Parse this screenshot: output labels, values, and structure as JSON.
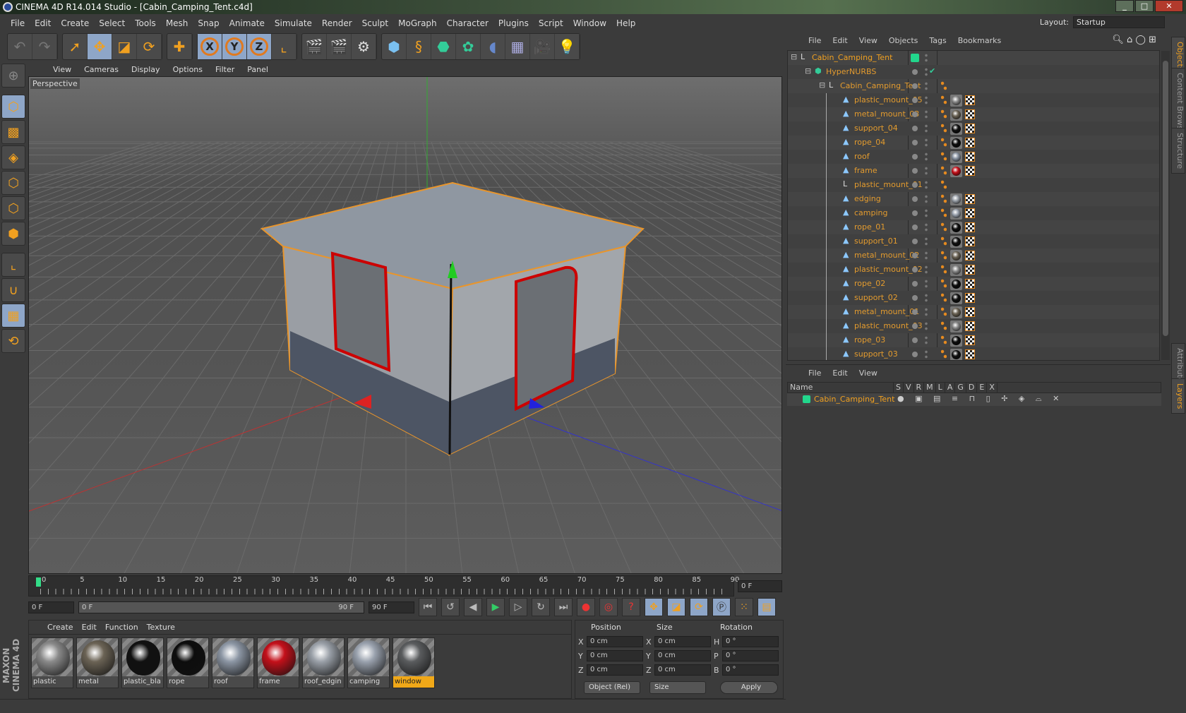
{
  "window": {
    "title": "CINEMA 4D R14.014 Studio - [Cabin_Camping_Tent.c4d]",
    "controls": [
      "_",
      "□",
      "✕"
    ]
  },
  "menu": [
    "File",
    "Edit",
    "Create",
    "Select",
    "Tools",
    "Mesh",
    "Snap",
    "Animate",
    "Simulate",
    "Render",
    "Sculpt",
    "MoGraph",
    "Character",
    "Plugins",
    "Script",
    "Window",
    "Help"
  ],
  "layout": {
    "label": "Layout:",
    "value": "Startup"
  },
  "toolbar": {
    "axes": [
      "X",
      "Y",
      "Z"
    ]
  },
  "viewport": {
    "menu": [
      "View",
      "Cameras",
      "Display",
      "Options",
      "Filter",
      "Panel"
    ],
    "label": "Perspective"
  },
  "timeline": {
    "ticks": [
      "0",
      "5",
      "10",
      "15",
      "20",
      "25",
      "30",
      "35",
      "40",
      "45",
      "50",
      "55",
      "60",
      "65",
      "70",
      "75",
      "80",
      "85",
      "90"
    ],
    "current": "0 F",
    "start": "0 F",
    "range_start": "0 F",
    "range_end": "90 F",
    "end": "90 F"
  },
  "materials": {
    "menu": [
      "Create",
      "Edit",
      "Function",
      "Texture"
    ],
    "items": [
      {
        "name": "plastic",
        "color": "#8a8a8a"
      },
      {
        "name": "metal",
        "color": "#6b6355"
      },
      {
        "name": "plastic_bla",
        "color": "#111111"
      },
      {
        "name": "rope",
        "color": "#0d0d0d"
      },
      {
        "name": "roof",
        "color": "#8c96a4"
      },
      {
        "name": "frame",
        "color": "#c4101a"
      },
      {
        "name": "roof_edgin",
        "color": "#9aa0a8"
      },
      {
        "name": "camping",
        "color": "#9aa2ae"
      },
      {
        "name": "window",
        "color": "#5a5c5e",
        "selected": true
      }
    ]
  },
  "coords": {
    "headers": [
      "Position",
      "Size",
      "Rotation"
    ],
    "rows": [
      {
        "a": "X",
        "p": "0 cm",
        "s": "X",
        "sv": "0 cm",
        "r": "H",
        "rv": "0 °"
      },
      {
        "a": "Y",
        "p": "0 cm",
        "s": "Y",
        "sv": "0 cm",
        "r": "P",
        "rv": "0 °"
      },
      {
        "a": "Z",
        "p": "0 cm",
        "s": "Z",
        "sv": "0 cm",
        "r": "B",
        "rv": "0 °"
      }
    ],
    "mode": "Object (Rel)",
    "size_mode": "Size",
    "apply": "Apply"
  },
  "logo": "MAXON CINEMA 4D",
  "objects": {
    "menu": [
      "File",
      "Edit",
      "View",
      "Objects",
      "Tags",
      "Bookmarks"
    ],
    "rows": [
      {
        "name": "Cabin_Camping_Tent",
        "level": 0,
        "icon": "null",
        "tags": []
      },
      {
        "name": "HyperNURBS",
        "level": 1,
        "icon": "hypernurbs",
        "tags": []
      },
      {
        "name": "Cabin_Camping_Tent",
        "level": 2,
        "icon": "null",
        "tags": [
          "phong"
        ]
      },
      {
        "name": "plastic_mount_05",
        "level": 3,
        "icon": "poly",
        "mat": "#8a8a8a"
      },
      {
        "name": "metal_mount_03",
        "level": 3,
        "icon": "poly",
        "mat": "#6b6355"
      },
      {
        "name": "support_04",
        "level": 3,
        "icon": "poly",
        "mat": "#111111"
      },
      {
        "name": "rope_04",
        "level": 3,
        "icon": "poly",
        "mat": "#0d0d0d"
      },
      {
        "name": "roof",
        "level": 3,
        "icon": "poly",
        "mat": "#8c96a4"
      },
      {
        "name": "frame",
        "level": 3,
        "icon": "poly",
        "mat": "#c4101a"
      },
      {
        "name": "plastic_mount_01",
        "level": 3,
        "icon": "null"
      },
      {
        "name": "edging",
        "level": 3,
        "icon": "poly",
        "mat": "#9aa0a8"
      },
      {
        "name": "camping",
        "level": 3,
        "icon": "poly",
        "mat": "#9aa2ae"
      },
      {
        "name": "rope_01",
        "level": 3,
        "icon": "poly",
        "mat": "#0d0d0d"
      },
      {
        "name": "support_01",
        "level": 3,
        "icon": "poly",
        "mat": "#111111"
      },
      {
        "name": "metal_mount_02",
        "level": 3,
        "icon": "poly",
        "mat": "#6b6355"
      },
      {
        "name": "plastic_mount_02",
        "level": 3,
        "icon": "poly",
        "mat": "#8a8a8a"
      },
      {
        "name": "rope_02",
        "level": 3,
        "icon": "poly",
        "mat": "#0d0d0d"
      },
      {
        "name": "support_02",
        "level": 3,
        "icon": "poly",
        "mat": "#111111"
      },
      {
        "name": "metal_mount_01",
        "level": 3,
        "icon": "poly",
        "mat": "#6b6355"
      },
      {
        "name": "plastic_mount_03",
        "level": 3,
        "icon": "poly",
        "mat": "#8a8a8a"
      },
      {
        "name": "rope_03",
        "level": 3,
        "icon": "poly",
        "mat": "#0d0d0d"
      },
      {
        "name": "support_03",
        "level": 3,
        "icon": "poly",
        "mat": "#111111"
      }
    ]
  },
  "layers": {
    "menu": [
      "File",
      "Edit",
      "View"
    ],
    "columns": [
      "Name",
      "S",
      "V",
      "R",
      "M",
      "L",
      "A",
      "G",
      "D",
      "E",
      "X"
    ],
    "row": {
      "name": "Cabin_Camping_Tent",
      "color": "#22d68c"
    }
  },
  "right_tabs": [
    "Objects",
    "Content Browser",
    "Structure",
    "Attributes",
    "Layers"
  ],
  "colors": {
    "accent": "#f0a020",
    "object_name": "#e39b2e",
    "selected_tool": "#8ea6c8"
  }
}
